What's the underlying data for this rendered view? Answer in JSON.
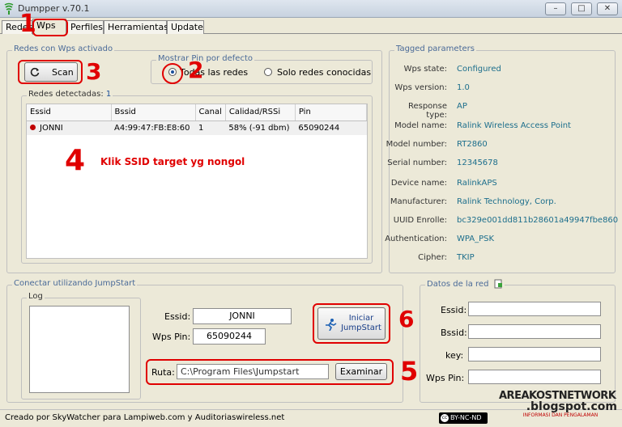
{
  "window": {
    "title": "Dumpper v.70.1"
  },
  "tabs": [
    "Redes",
    "Wps",
    "Perfiles",
    "Herramientas",
    "Update"
  ],
  "wps_group": {
    "title": "Redes con Wps activado",
    "scan_label": "Scan"
  },
  "pin_group": {
    "title": "Mostrar Pin por defecto",
    "option_all": "Todas las redes",
    "option_known": "Solo redes conocidas"
  },
  "detected": {
    "label": "Redes detectadas:",
    "count": "1"
  },
  "table": {
    "headers": [
      "Essid",
      "Bssid",
      "Canal",
      "Calidad/RSSi",
      "Pin"
    ],
    "rows": [
      {
        "essid": "JONNI",
        "bssid": "A4:99:47:FB:E8:60",
        "canal": "1",
        "calidad": "58% (-91 dbm)",
        "pin": "65090244"
      }
    ]
  },
  "annotations": {
    "note": "Klik SSID target yg nongol",
    "n1": "1",
    "n2": "2",
    "n3": "3",
    "n4": "4",
    "n5": "5",
    "n6": "6"
  },
  "tagged": {
    "title": "Tagged parameters",
    "items": [
      {
        "k": "Wps state:",
        "v": "Configured"
      },
      {
        "k": "Wps version:",
        "v": "1.0"
      },
      {
        "k": "Response type:",
        "v": "AP"
      },
      {
        "k": "Model name:",
        "v": "Ralink Wireless Access Point"
      },
      {
        "k": "Model number:",
        "v": "RT2860"
      },
      {
        "k": "Serial number:",
        "v": "12345678"
      },
      {
        "k": "Device name:",
        "v": "RalinkAPS"
      },
      {
        "k": "Manufacturer:",
        "v": "Ralink Technology, Corp."
      },
      {
        "k": "UUID Enrolle:",
        "v": "bc329e001dd811b28601a49947fbe860"
      },
      {
        "k": "Authentication:",
        "v": "WPA_PSK"
      },
      {
        "k": "Cipher:",
        "v": "TKIP"
      }
    ]
  },
  "jumpstart": {
    "title": "Conectar utilizando JumpStart",
    "log_label": "Log",
    "essid_label": "Essid:",
    "essid_value": "JONNI",
    "pin_label": "Wps Pin:",
    "pin_value": "65090244",
    "start_label_1": "Iniciar",
    "start_label_2": "JumpStart",
    "ruta_label": "Ruta:",
    "ruta_value": "C:\\Program Files\\Jumpstart",
    "browse_label": "Examinar"
  },
  "netdata": {
    "title": "Datos de la red",
    "essid": "Essid:",
    "bssid": "Bssid:",
    "key": "key:",
    "pin": "Wps Pin:"
  },
  "status": {
    "credits": "Creado por SkyWatcher para Lampiweb.com y Auditoriaswireless.net",
    "license": "BY-NC-ND"
  },
  "watermark": {
    "line1": "AREAKOSTNETWORK",
    "line2": ".blogspot.com",
    "line3": "INFORMASI DAN PENGALAMAN"
  }
}
